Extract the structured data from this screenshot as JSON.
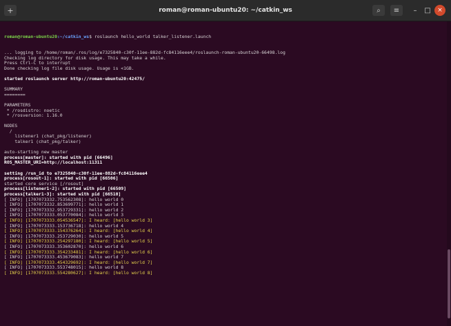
{
  "window": {
    "title": "roman@roman-ubuntu20: ~/catkin_ws",
    "buttons": {
      "new_tab": "+",
      "search": "⌕",
      "menu": "≡",
      "minimize": "–",
      "maximize": "□",
      "close": "×"
    }
  },
  "terminal": {
    "prompt": {
      "user_host": "roman@roman-ubuntu20",
      "path": ":~/catkin_ws",
      "symbol": "$",
      "command": "roslaunch hello_world talker_listener.launch"
    },
    "lines": [
      "... logging to /home/roman/.ros/log/e7325840-c30f-11ee-882d-fc84116eee4/roslaunch-roman-ubuntu20-66498.log",
      "Checking log directory for disk usage. This may take a while.",
      "Press Ctrl-C to interrupt",
      "Done checking log file disk usage. Usage is <1GB.",
      "",
      "started roslaunch server http://roman-ubuntu20:42475/",
      "",
      "SUMMARY",
      "========",
      "",
      "PARAMETERS",
      " * /rosdistro: noetic",
      " * /rosversion: 1.16.0",
      "",
      "NODES",
      "  /",
      "    listener1 (chat_pkg/listener)",
      "    talker1 (chat_pkg/talker)",
      "",
      "auto-starting new master",
      "process[master]: started with pid [66496]",
      "ROS_MASTER_URI=http://localhost:11311",
      "",
      "setting /run_id to e7325840-c30f-11ee-882d-fc84116eee4",
      "process[rosout-1]: started with pid [66506]",
      "started core service [/rosout]",
      "process[listener1-2]: started with pid [66509]",
      "process[talker1-3]: started with pid [66510]",
      "[ INFO] [1707073332.753562308]: hello world 0",
      "[ INFO] [1707073332.853699771]: hello world 1",
      "[ INFO] [1707073332.953729331]: hello world 2",
      "[ INFO] [1707073333.053770084]: hello world 3",
      "[ INFO] [1707073333.054536547]: I heard: [hello world 3]",
      "[ INFO] [1707073333.153736718]: hello world 4",
      "[ INFO] [1707073333.154376264]: I heard: [hello world 4]",
      "[ INFO] [1707073333.253729030]: hello world 5",
      "[ INFO] [1707073333.254297180]: I heard: [hello world 5]",
      "[ INFO] [1707073333.353602870]: hello world 6",
      "[ INFO] [1707073333.354233481]: I heard: [hello world 6]",
      "[ INFO] [1707073333.453679083]: hello world 7",
      "[ INFO] [1707073333.454329692]: I heard: [hello world 7]",
      "[ INFO] [1707073333.553748015]: hello world 8",
      "[ INFO] [1707073333.554280627]: I heard: [hello world 8]"
    ]
  }
}
